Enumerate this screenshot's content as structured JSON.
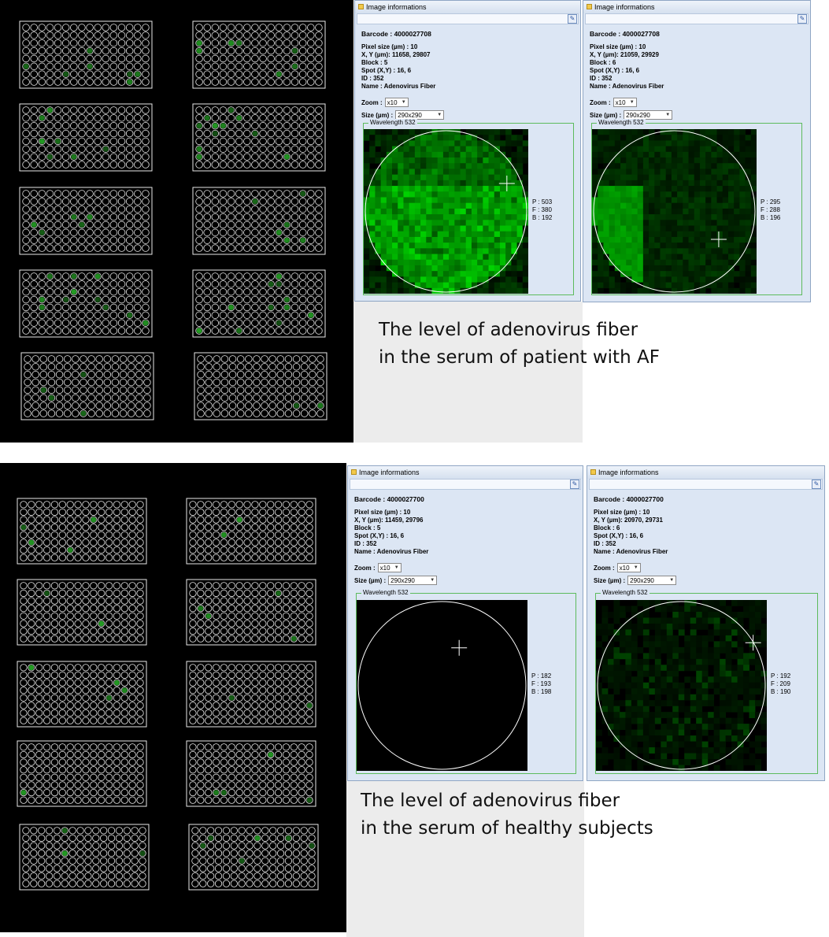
{
  "captions": {
    "top_line1": "The level of adenovirus fiber",
    "top_line2": "in the serum of patient with AF",
    "bottom_line1": "The level of adenovirus fiber",
    "bottom_line2": "in the serum of healthy subjects"
  },
  "panels": [
    {
      "title": "Image informations",
      "barcode": "Barcode : 4000027708",
      "pixel_size": "Pixel size (µm) : 10",
      "xy": "X, Y (µm): 11658, 29807",
      "block": "Block : 5",
      "spot": "Spot (X,Y) : 16, 6",
      "id": "ID : 352",
      "name": "Name : Adenovirus Fiber",
      "zoom_label": "Zoom :",
      "zoom_value": "x10",
      "size_label": "Size (µm) :",
      "size_value": "290x290",
      "wavelength": "Wavelength 532",
      "p": "P : 503",
      "f": "F : 380",
      "b": "B : 192"
    },
    {
      "title": "Image informations",
      "barcode": "Barcode : 4000027708",
      "pixel_size": "Pixel size (µm) : 10",
      "xy": "X, Y (µm): 21059, 29929",
      "block": "Block : 6",
      "spot": "Spot (X,Y) : 16, 6",
      "id": "ID : 352",
      "name": "Name : Adenovirus Fiber",
      "zoom_label": "Zoom :",
      "zoom_value": "x10",
      "size_label": "Size (µm) :",
      "size_value": "290x290",
      "wavelength": "Wavelength 532",
      "p": "P : 295",
      "f": "F : 288",
      "b": "B : 196"
    },
    {
      "title": "Image informations",
      "barcode": "Barcode : 4000027700",
      "pixel_size": "Pixel size (µm) : 10",
      "xy": "X, Y (µm): 11459, 29796",
      "block": "Block : 5",
      "spot": "Spot (X,Y) : 16, 6",
      "id": "ID : 352",
      "name": "Name : Adenovirus Fiber",
      "zoom_label": "Zoom :",
      "zoom_value": "x10",
      "size_label": "Size (µm) :",
      "size_value": "290x290",
      "wavelength": "Wavelength 532",
      "p": "P : 182",
      "f": "F : 193",
      "b": "B : 198"
    },
    {
      "title": "Image informations",
      "barcode": "Barcode : 4000027700",
      "pixel_size": "Pixel size (µm) : 10",
      "xy": "X, Y (µm): 20970, 29731",
      "block": "Block : 6",
      "spot": "Spot (X,Y) : 16, 6",
      "id": "ID : 352",
      "name": "Name : Adenovirus Fiber",
      "zoom_label": "Zoom :",
      "zoom_value": "x10",
      "size_label": "Size (µm) :",
      "size_value": "290x290",
      "wavelength": "Wavelength 532",
      "p": "P : 192",
      "f": "F : 209",
      "b": "B : 190"
    }
  ],
  "colors": {
    "panel_bg": "#dce6f4",
    "spot_green": "#2fd12f",
    "grid_line": "#e8e8e8",
    "wavelength_border": "#5dbb5d"
  }
}
